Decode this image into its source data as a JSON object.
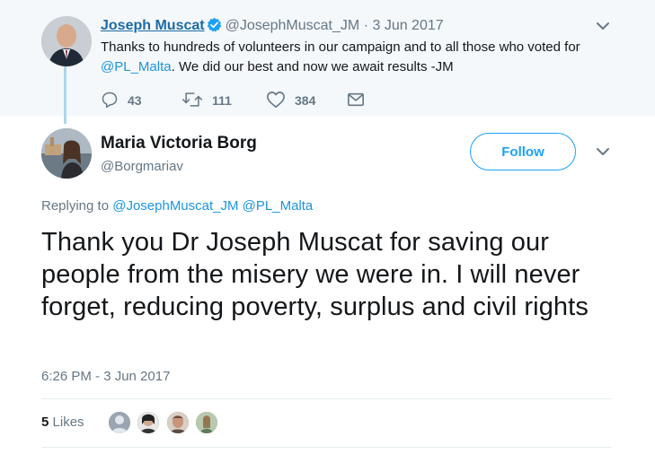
{
  "parent_tweet": {
    "author_name": "Joseph Muscat",
    "author_handle": "@JosephMuscat_JM",
    "separator": "·",
    "date": "3 Jun 2017",
    "text_before": "Thanks to hundreds of volunteers in our campaign and to all those who voted for ",
    "mention": "@PL_Malta",
    "text_after": ". We did our best and now we await results -JM",
    "reply_count": "43",
    "retweet_count": "111",
    "like_count": "384"
  },
  "tweet": {
    "author_name": "Maria Victoria Borg",
    "author_handle": "@Borgmariav",
    "follow_label": "Follow",
    "replying_prefix": "Replying to ",
    "replying_mention_1": "@JosephMuscat_JM",
    "replying_mention_2": "@PL_Malta",
    "text": "Thank you Dr Joseph Muscat for saving our people from the misery we were in. I will never forget, reducing poverty, surplus and civil rights",
    "timestamp": "6:26 PM - 3 Jun 2017",
    "likes_count": "5",
    "likes_label": "Likes"
  },
  "icons": [
    "verified-badge-icon",
    "chevron-down-icon",
    "reply-icon",
    "retweet-icon",
    "heart-icon",
    "envelope-icon"
  ],
  "colors": {
    "link": "#1b95e0",
    "follow_blue": "#1da1f2",
    "muted": "#657786",
    "parent_bg": "#f5f8fa",
    "thread_line": "#aad8ee"
  }
}
